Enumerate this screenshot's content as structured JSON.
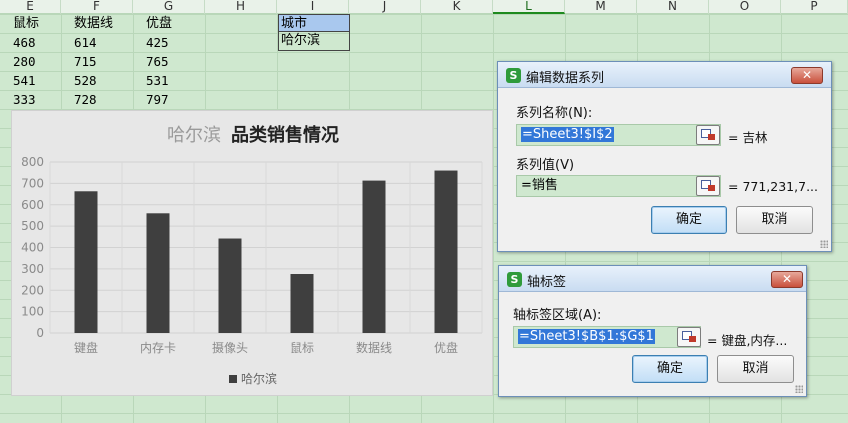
{
  "sheet": {
    "columns": [
      "E",
      "F",
      "G",
      "H",
      "I",
      "J",
      "K",
      "L",
      "M",
      "N",
      "O",
      "P"
    ],
    "selected_column": "L",
    "headers": {
      "e": "鼠标",
      "f": "数据线",
      "g": "优盘"
    },
    "rows": [
      {
        "e": "468",
        "f": "614",
        "g": "425"
      },
      {
        "e": "280",
        "f": "715",
        "g": "765"
      },
      {
        "e": "541",
        "f": "528",
        "g": "531"
      },
      {
        "e": "333",
        "f": "728",
        "g": "797"
      }
    ],
    "i1": "城市",
    "i2": "哈尔滨"
  },
  "chart_data": {
    "type": "bar",
    "title": "品类销售情况",
    "series_label": "哈尔滨",
    "categories": [
      "键盘",
      "内存卡",
      "摄像头",
      "鼠标",
      "数据线",
      "优盘"
    ],
    "series": [
      {
        "name": "哈尔滨",
        "values": [
          663,
          560,
          442,
          276,
          713,
          760
        ],
        "color": "#3f3f3f"
      }
    ],
    "ylim": [
      0,
      800
    ],
    "yticks": [
      0,
      100,
      200,
      300,
      400,
      500,
      600,
      700,
      800
    ],
    "legend": "bottom",
    "grid": true
  },
  "dialog_series": {
    "title": "编辑数据系列",
    "close_label": "✕",
    "name_label": "系列名称(N):",
    "name_value": "=Sheet3!$I$2",
    "name_preview": "= 吉林",
    "values_label": "系列值(V)",
    "values_value": "=销售",
    "values_preview": "= 771,231,7...",
    "ok_label": "确定",
    "cancel_label": "取消"
  },
  "dialog_axis": {
    "title": "轴标签",
    "close_label": "✕",
    "range_label": "轴标签区域(A):",
    "range_value": "=Sheet3!$B$1:$G$1",
    "range_preview": "= 键盘,内存...",
    "ok_label": "确定",
    "cancel_label": "取消"
  }
}
